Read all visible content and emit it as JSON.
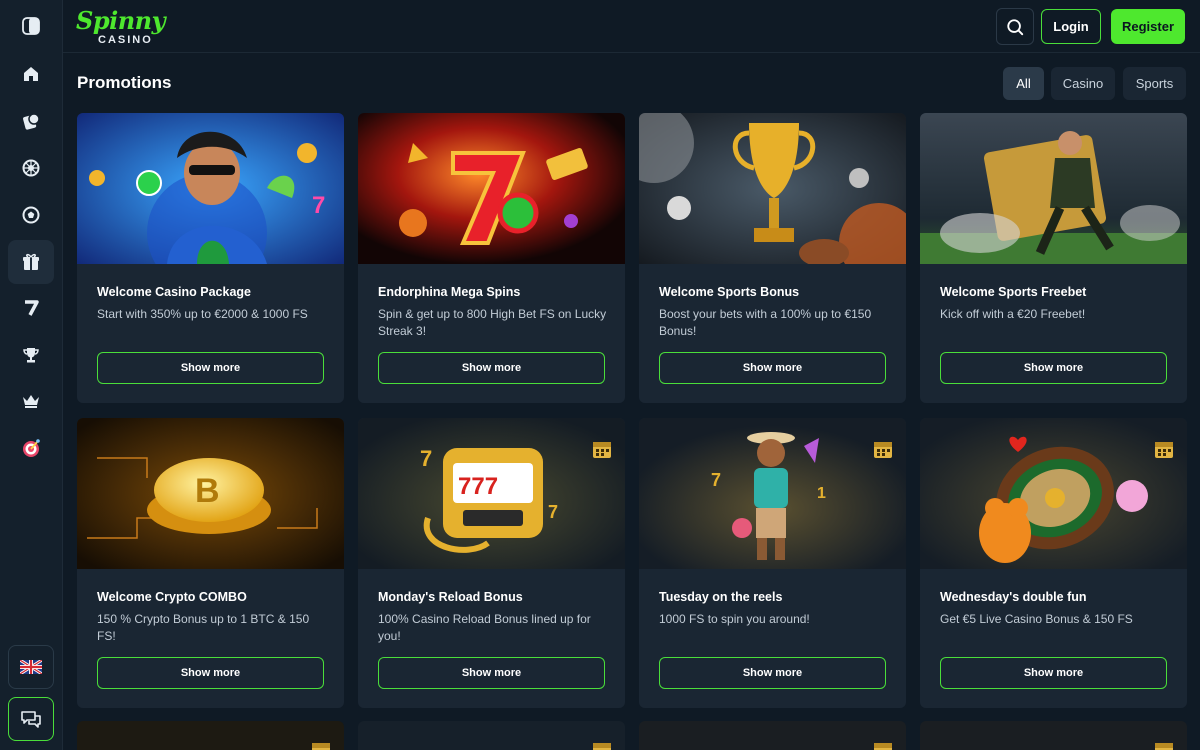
{
  "header": {
    "logo_text": "Spinny",
    "logo_sub": "CASINO",
    "login_label": "Login",
    "register_label": "Register"
  },
  "page": {
    "title": "Promotions",
    "filters": [
      {
        "label": "All",
        "active": true
      },
      {
        "label": "Casino",
        "active": false
      },
      {
        "label": "Sports",
        "active": false
      }
    ]
  },
  "promotions": [
    {
      "title": "Welcome Casino Package",
      "description": "Start with 350% up to €2000 & 1000 FS",
      "button": "Show more"
    },
    {
      "title": "Endorphina Mega Spins",
      "description": "Spin & get up to 800 High Bet FS on Lucky Streak 3!",
      "button": "Show more"
    },
    {
      "title": "Welcome Sports Bonus",
      "description": "Boost your bets with a 100% up to €150 Bonus!",
      "button": "Show more"
    },
    {
      "title": "Welcome Sports Freebet",
      "description": "Kick off with a €20 Freebet!",
      "button": "Show more"
    },
    {
      "title": "Welcome Crypto COMBO",
      "description": "150 % Crypto Bonus up to 1 BTC & 150 FS!",
      "button": "Show more"
    },
    {
      "title": "Monday's Reload Bonus",
      "description": "100% Casino Reload Bonus lined up for you!",
      "button": "Show more"
    },
    {
      "title": "Tuesday on the reels",
      "description": "1000 FS to spin you around!",
      "button": "Show more"
    },
    {
      "title": "Wednesday's double fun",
      "description": "Get €5 Live Casino Bonus & 150 FS",
      "button": "Show more"
    }
  ],
  "colors": {
    "background": "#0f1a25",
    "card": "#1a2633",
    "accent": "#4ee82e"
  },
  "icons": {
    "sidebar": [
      "sidebar-toggle-icon",
      "home-icon",
      "casino-chip-icon",
      "roulette-icon",
      "football-icon",
      "gift-icon",
      "seven-icon",
      "trophy-icon",
      "crown-icon",
      "target-icon"
    ],
    "bottom": [
      "uk-flag-icon",
      "chat-icon"
    ]
  }
}
